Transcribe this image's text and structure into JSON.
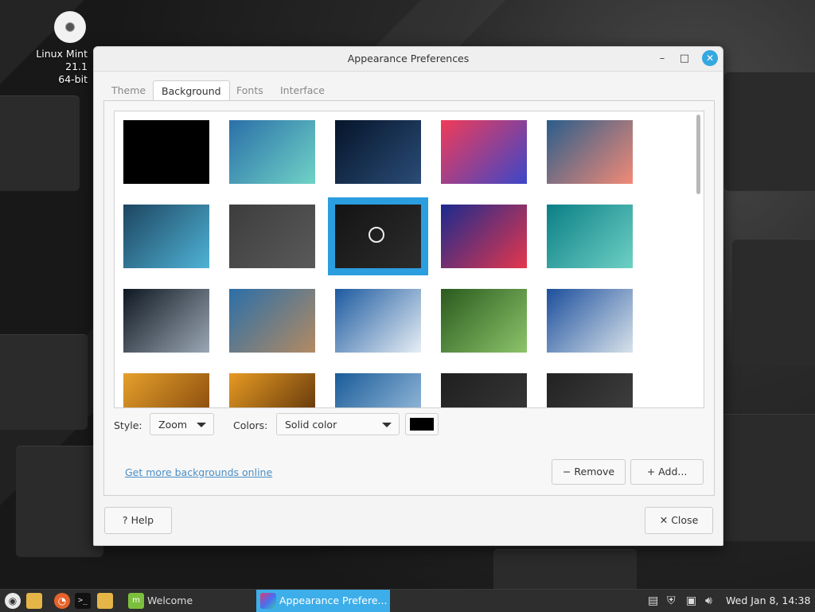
{
  "desktop": {
    "icon_line1": "Linux Mint 21.1",
    "icon_line2": "64-bit"
  },
  "window": {
    "title": "Appearance Preferences",
    "controls": {
      "minimize": "–",
      "maximize": "□",
      "close": "✕"
    }
  },
  "tabs": [
    {
      "label": "Theme",
      "active": false
    },
    {
      "label": "Background",
      "active": true
    },
    {
      "label": "Fonts",
      "active": false
    },
    {
      "label": "Interface",
      "active": false
    }
  ],
  "gallery": {
    "selected_index": 7,
    "thumbnails": [
      {
        "name": "black",
        "colors": [
          "#000000",
          "#000000"
        ]
      },
      {
        "name": "aqua-waves",
        "colors": [
          "#2b6fa8",
          "#6fd3c6"
        ]
      },
      {
        "name": "dark-lines",
        "colors": [
          "#06152a",
          "#2a4c77"
        ]
      },
      {
        "name": "rainbow-bubble",
        "colors": [
          "#f13b58",
          "#3b47c9"
        ]
      },
      {
        "name": "sunset-sea",
        "colors": [
          "#2a5d8b",
          "#f28a76"
        ]
      },
      {
        "name": "blue-cubes",
        "colors": [
          "#1d4560",
          "#4fb3d6"
        ]
      },
      {
        "name": "cracked-asphalt",
        "colors": [
          "#3d3d3d",
          "#5a5a5a"
        ]
      },
      {
        "name": "mint-logo-dark",
        "colors": [
          "#141414",
          "#2c2c2c"
        ]
      },
      {
        "name": "red-blue-ripples",
        "colors": [
          "#1b2a8e",
          "#e4374d"
        ]
      },
      {
        "name": "lagoon-ruins",
        "colors": [
          "#0b7f86",
          "#6ed0c4"
        ]
      },
      {
        "name": "frozen-bubble",
        "colors": [
          "#0f1822",
          "#9ba7b4"
        ]
      },
      {
        "name": "bubble-sea",
        "colors": [
          "#2b6fa8",
          "#b38a62"
        ]
      },
      {
        "name": "snowy-mountains",
        "colors": [
          "#1d5aa0",
          "#e7eef4"
        ]
      },
      {
        "name": "green-grass",
        "colors": [
          "#2a5a1e",
          "#8cc46a"
        ]
      },
      {
        "name": "greek-terrace",
        "colors": [
          "#1c4f9c",
          "#d8e2ea"
        ]
      },
      {
        "name": "orange-sky",
        "colors": [
          "#e5a02a",
          "#7a3d0a"
        ]
      },
      {
        "name": "palm-sunset",
        "colors": [
          "#e79a22",
          "#4b2608"
        ]
      },
      {
        "name": "coast-clouds",
        "colors": [
          "#1a5c99",
          "#a9c8e4"
        ]
      },
      {
        "name": "dark-floor",
        "colors": [
          "#1f1f1f",
          "#3a3a3a"
        ]
      },
      {
        "name": "dark-texture",
        "colors": [
          "#222222",
          "#444444"
        ]
      }
    ]
  },
  "controls": {
    "style_label": "Style:",
    "style_value": "Zoom",
    "colors_label": "Colors:",
    "colors_value": "Solid color",
    "swatch_color": "#000000"
  },
  "link": "Get more backgrounds online",
  "buttons": {
    "remove": "Remove",
    "add": "Add...",
    "help": "Help",
    "close": "Close"
  },
  "taskbar": {
    "tasks": [
      {
        "label": "Welcome",
        "active": false
      },
      {
        "label": "Appearance Prefere...",
        "active": true
      }
    ],
    "clock": "Wed Jan  8, 14:38"
  }
}
